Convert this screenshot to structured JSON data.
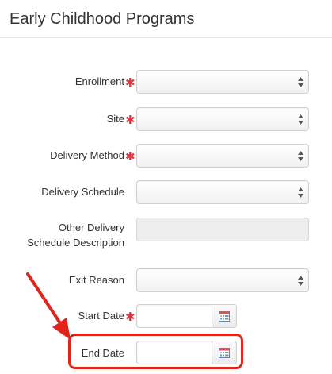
{
  "page": {
    "title": "Early Childhood Programs"
  },
  "form": {
    "required_mark": "✱",
    "fields": [
      {
        "label": "Enrollment",
        "required": true,
        "type": "select",
        "value": ""
      },
      {
        "label": "Site",
        "required": true,
        "type": "select",
        "value": ""
      },
      {
        "label": "Delivery Method",
        "required": true,
        "type": "select",
        "value": ""
      },
      {
        "label": "Delivery Schedule",
        "required": false,
        "type": "select",
        "value": ""
      },
      {
        "label": "Other Delivery Schedule Description",
        "label_lines": [
          "Other Delivery",
          "Schedule Description"
        ],
        "required": false,
        "type": "disabled-text",
        "value": ""
      },
      {
        "label": "Exit Reason",
        "required": false,
        "type": "select",
        "value": ""
      },
      {
        "label": "Start Date",
        "required": true,
        "type": "date",
        "value": ""
      },
      {
        "label": "End Date",
        "required": false,
        "type": "date",
        "value": ""
      }
    ]
  },
  "icons": {
    "select_arrows": "up-down-arrows-icon",
    "calendar": "calendar-icon",
    "annotation_arrow": "red-arrow-annotation"
  },
  "colors": {
    "required": "#d9363e",
    "annotation": "#e2231a",
    "border": "#cfcfcf"
  }
}
